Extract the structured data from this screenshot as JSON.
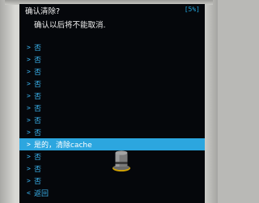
{
  "screen": {
    "title": "确认清除?",
    "battery": "[5%]",
    "subtitle": "确认以后将不能取消."
  },
  "menu": {
    "arrow_glyph": ">",
    "back_glyph": "<",
    "items": [
      {
        "label": "否"
      },
      {
        "label": "否"
      },
      {
        "label": "否"
      },
      {
        "label": "否"
      },
      {
        "label": "否"
      },
      {
        "label": "否"
      },
      {
        "label": "否"
      },
      {
        "label": "否"
      },
      {
        "label": "是的，清除cache",
        "selected": true
      },
      {
        "label": "否"
      },
      {
        "label": "否"
      },
      {
        "label": "否"
      },
      {
        "label": "返回"
      }
    ]
  },
  "icons": {
    "recovery_hat": "top-hat-icon"
  },
  "colors": {
    "background": "#05070b",
    "text": "#e8e8e8",
    "accent": "#3ab3ee",
    "selection": "#2ca6df"
  }
}
